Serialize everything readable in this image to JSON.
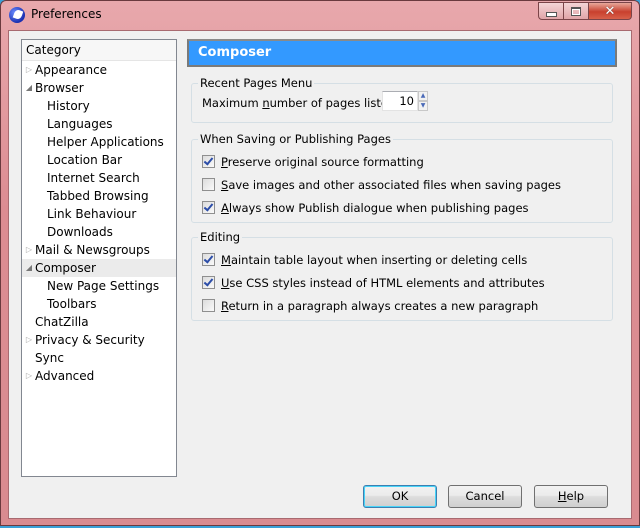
{
  "window": {
    "title": "Preferences",
    "caption_buttons": {
      "minimize": "minimize",
      "maximize": "maximize",
      "close": "close"
    }
  },
  "sidebar": {
    "header": "Category",
    "items": [
      {
        "label": "Appearance",
        "level": 0,
        "twisty": "closed"
      },
      {
        "label": "Browser",
        "level": 0,
        "twisty": "open"
      },
      {
        "label": "History",
        "level": 1
      },
      {
        "label": "Languages",
        "level": 1
      },
      {
        "label": "Helper Applications",
        "level": 1
      },
      {
        "label": "Location Bar",
        "level": 1
      },
      {
        "label": "Internet Search",
        "level": 1
      },
      {
        "label": "Tabbed Browsing",
        "level": 1
      },
      {
        "label": "Link Behaviour",
        "level": 1
      },
      {
        "label": "Downloads",
        "level": 1
      },
      {
        "label": "Mail & Newsgroups",
        "level": 0,
        "twisty": "closed"
      },
      {
        "label": "Composer",
        "level": 0,
        "twisty": "open",
        "selected": true
      },
      {
        "label": "New Page Settings",
        "level": 1
      },
      {
        "label": "Toolbars",
        "level": 1
      },
      {
        "label": "ChatZilla",
        "level": 0
      },
      {
        "label": "Privacy & Security",
        "level": 0,
        "twisty": "closed"
      },
      {
        "label": "Sync",
        "level": 0
      },
      {
        "label": "Advanced",
        "level": 0,
        "twisty": "closed"
      }
    ]
  },
  "pane": {
    "title": "Composer",
    "header_color": "#3399ff",
    "recent_pages": {
      "legend": "Recent Pages Menu",
      "label_pre": "Maximum ",
      "label_accel": "n",
      "label_post": "umber of pages listed:",
      "value": "10"
    },
    "saving": {
      "legend": "When Saving or Publishing Pages",
      "options": [
        {
          "accel": "P",
          "rest": "reserve original source formatting",
          "checked": true
        },
        {
          "accel": "S",
          "rest": "ave images and other associated files when saving pages",
          "checked": false
        },
        {
          "accel": "A",
          "rest": "lways show Publish dialogue when publishing pages",
          "checked": true
        }
      ]
    },
    "editing": {
      "legend": "Editing",
      "options": [
        {
          "accel": "M",
          "rest": "aintain table layout when inserting or deleting cells",
          "checked": true
        },
        {
          "accel": "U",
          "rest": "se CSS styles instead of HTML elements and attributes",
          "checked": true
        },
        {
          "accel": "R",
          "rest": "eturn in a paragraph always creates a new paragraph",
          "checked": false
        }
      ]
    }
  },
  "buttons": {
    "ok": "OK",
    "cancel": "Cancel",
    "help_accel": "H",
    "help_rest": "elp"
  }
}
